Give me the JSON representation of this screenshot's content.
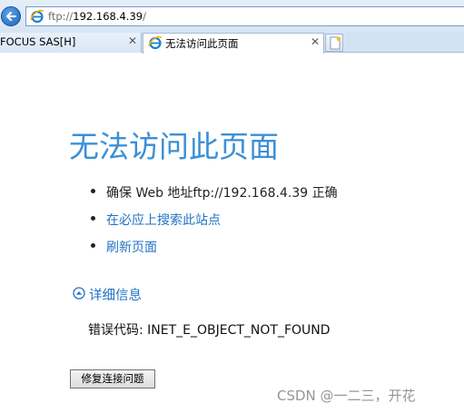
{
  "addressbar": {
    "url_scheme": "ftp://",
    "url_host": "192.168.4.39",
    "url_path": "/"
  },
  "tabs": [
    {
      "label": "FOCUS SAS[H]",
      "close": "✕"
    },
    {
      "label": "无法访问此页面",
      "close": "✕"
    }
  ],
  "icons": {
    "back": "back-arrow-icon",
    "browser": "ie-logo-icon",
    "new_tab": "new-tab-icon",
    "details_toggle": "chevron-up-circle-icon"
  },
  "main": {
    "title": "无法访问此页面",
    "suggestions": [
      "确保 Web 地址ftp://192.168.4.39 正确",
      "在必应上搜索此站点",
      "刷新页面"
    ],
    "details_label": "详细信息",
    "error_code": "错误代码: INET_E_OBJECT_NOT_FOUND",
    "fix_button": "修复连接问题"
  },
  "watermark": "CSDN @一二三，开花",
  "colors": {
    "title": "#3c8fd6",
    "link": "#1f73c3",
    "chrome": "#d4e3f4"
  }
}
